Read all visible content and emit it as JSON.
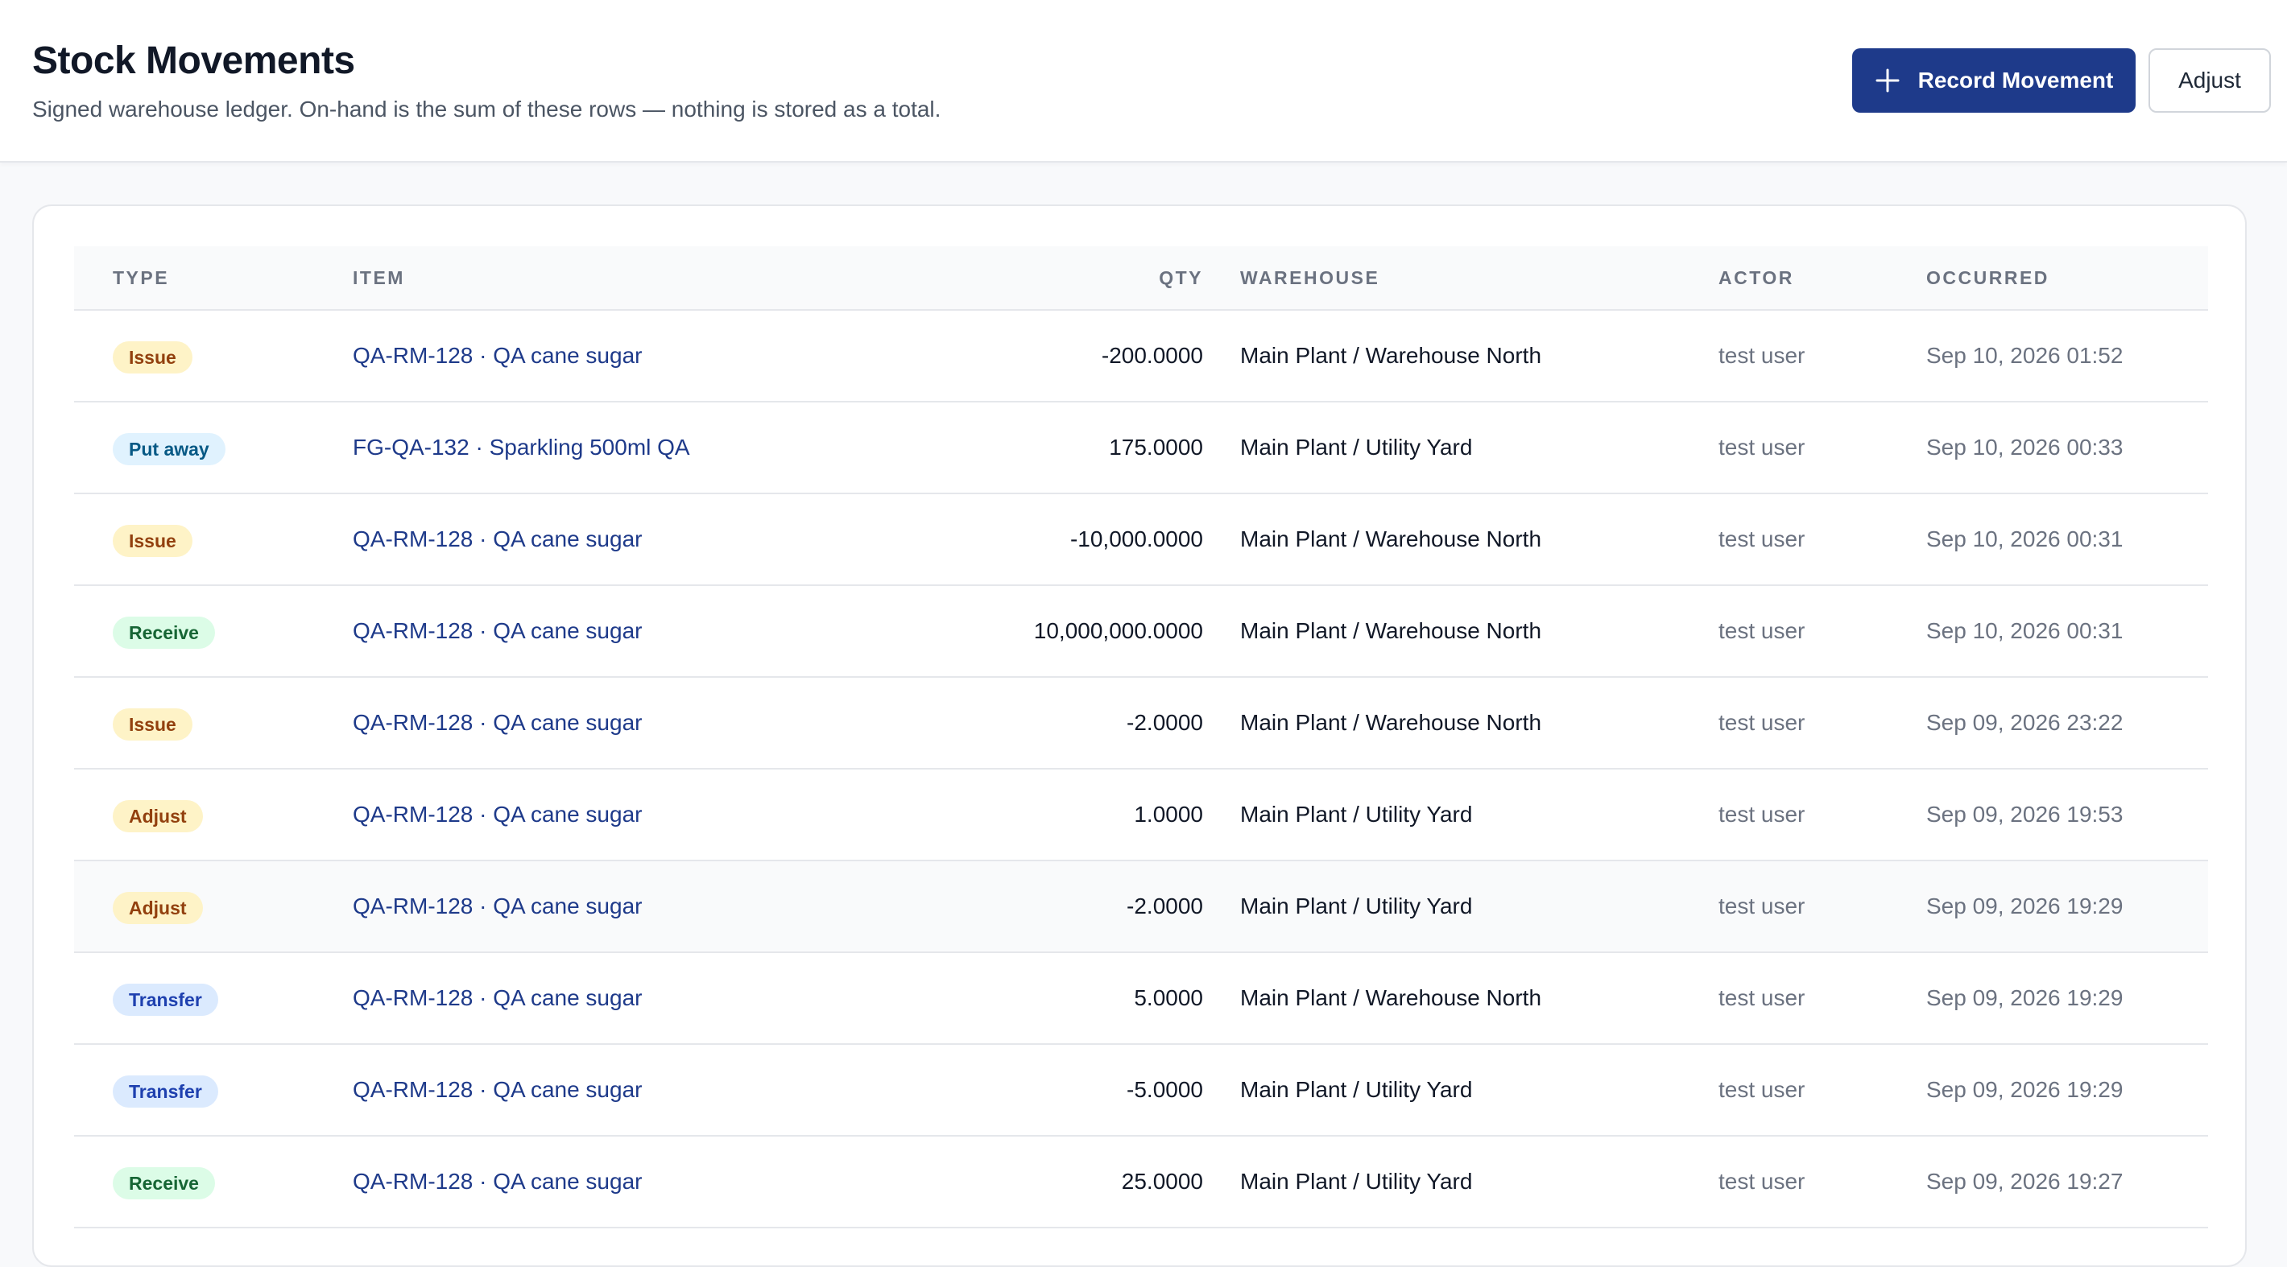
{
  "header": {
    "title": "Stock Movements",
    "subtitle": "Signed warehouse ledger. On-hand is the sum of these rows — nothing is stored as a total.",
    "primary_action_label": "Record Movement",
    "secondary_action_label": "Adjust"
  },
  "table": {
    "columns": {
      "type": "TYPE",
      "item": "ITEM",
      "qty": "QTY",
      "warehouse": "WAREHOUSE",
      "actor": "ACTOR",
      "occurred": "OCCURRED"
    },
    "rows": [
      {
        "type": "Issue",
        "type_kind": "issue",
        "item": "QA-RM-128 · QA cane sugar",
        "qty": "-200.0000",
        "warehouse": "Main Plant / Warehouse North",
        "actor": "test user",
        "occurred": "Sep 10, 2026 01:52"
      },
      {
        "type": "Put away",
        "type_kind": "putaway",
        "item": "FG-QA-132 · Sparkling 500ml QA",
        "qty": "175.0000",
        "warehouse": "Main Plant / Utility Yard",
        "actor": "test user",
        "occurred": "Sep 10, 2026 00:33"
      },
      {
        "type": "Issue",
        "type_kind": "issue",
        "item": "QA-RM-128 · QA cane sugar",
        "qty": "-10,000.0000",
        "warehouse": "Main Plant / Warehouse North",
        "actor": "test user",
        "occurred": "Sep 10, 2026 00:31"
      },
      {
        "type": "Receive",
        "type_kind": "receive",
        "item": "QA-RM-128 · QA cane sugar",
        "qty": "10,000,000.0000",
        "warehouse": "Main Plant / Warehouse North",
        "actor": "test user",
        "occurred": "Sep 10, 2026 00:31"
      },
      {
        "type": "Issue",
        "type_kind": "issue",
        "item": "QA-RM-128 · QA cane sugar",
        "qty": "-2.0000",
        "warehouse": "Main Plant / Warehouse North",
        "actor": "test user",
        "occurred": "Sep 09, 2026 23:22"
      },
      {
        "type": "Adjust",
        "type_kind": "adjust",
        "item": "QA-RM-128 · QA cane sugar",
        "qty": "1.0000",
        "warehouse": "Main Plant / Utility Yard",
        "actor": "test user",
        "occurred": "Sep 09, 2026 19:53"
      },
      {
        "type": "Adjust",
        "type_kind": "adjust",
        "item": "QA-RM-128 · QA cane sugar",
        "qty": "-2.0000",
        "warehouse": "Main Plant / Utility Yard",
        "actor": "test user",
        "occurred": "Sep 09, 2026 19:29"
      },
      {
        "type": "Transfer",
        "type_kind": "transfer",
        "item": "QA-RM-128 · QA cane sugar",
        "qty": "5.0000",
        "warehouse": "Main Plant / Warehouse North",
        "actor": "test user",
        "occurred": "Sep 09, 2026 19:29"
      },
      {
        "type": "Transfer",
        "type_kind": "transfer",
        "item": "QA-RM-128 · QA cane sugar",
        "qty": "-5.0000",
        "warehouse": "Main Plant / Utility Yard",
        "actor": "test user",
        "occurred": "Sep 09, 2026 19:29"
      },
      {
        "type": "Receive",
        "type_kind": "receive",
        "item": "QA-RM-128 · QA cane sugar",
        "qty": "25.0000",
        "warehouse": "Main Plant / Utility Yard",
        "actor": "test user",
        "occurred": "Sep 09, 2026 19:27"
      }
    ]
  },
  "icons": {
    "primary_action_icon": "plus-icon"
  },
  "colors": {
    "primary": "#1e3a8a",
    "issue_badge": "#fef3c7",
    "putaway_badge": "#e0f2fe",
    "receive_badge": "#dcfce7",
    "adjust_badge": "#fef3c7",
    "transfer_badge": "#dbeafe"
  }
}
